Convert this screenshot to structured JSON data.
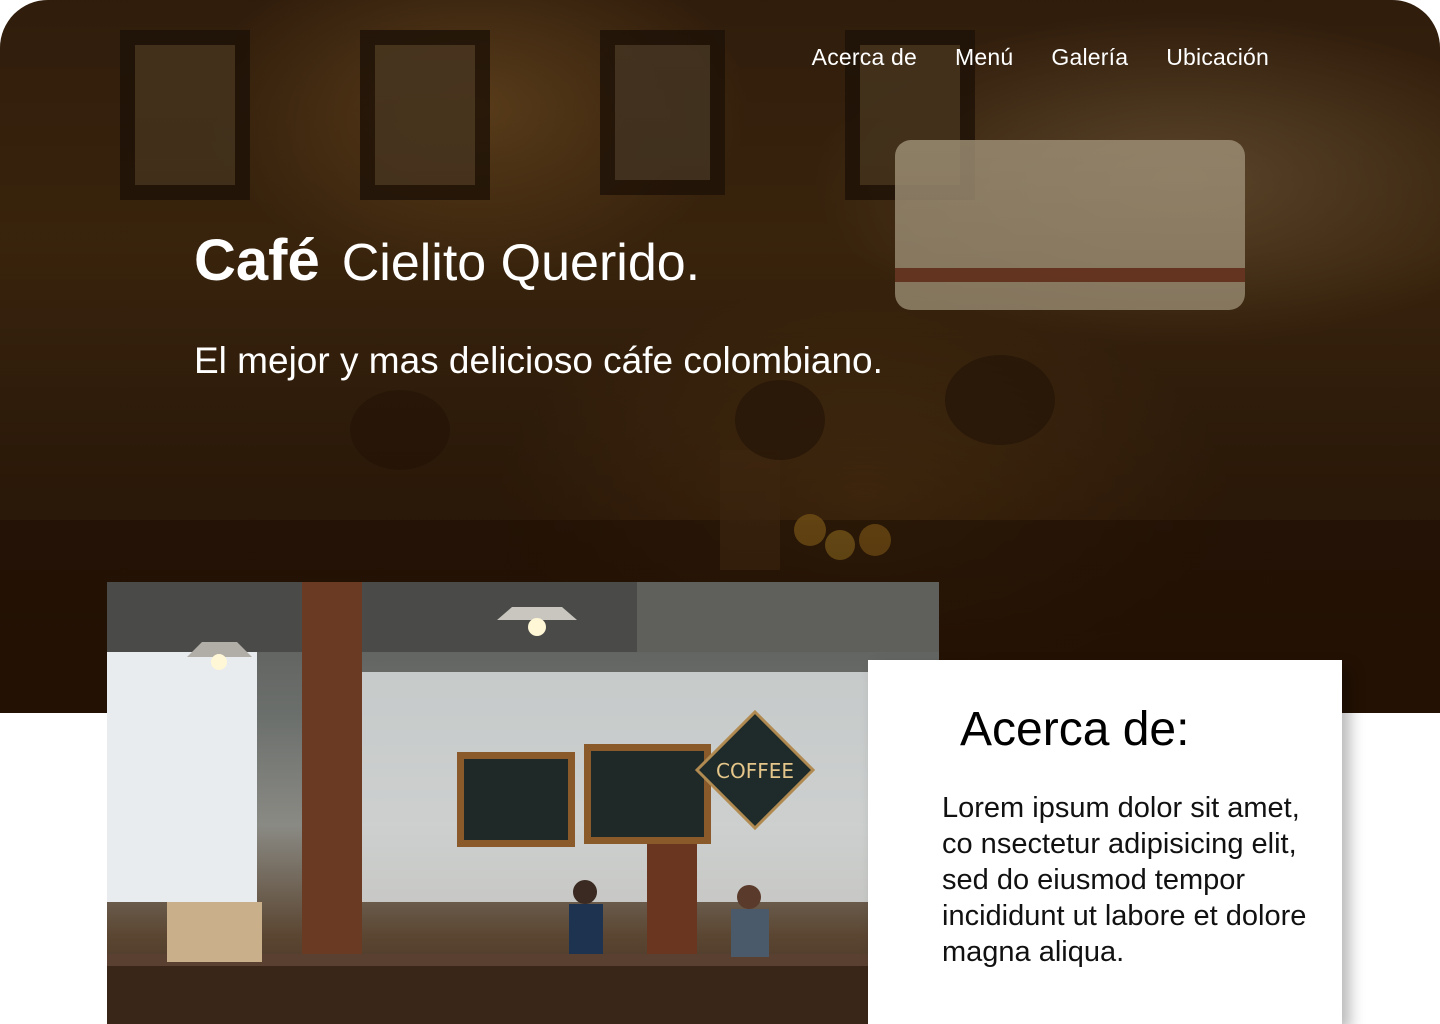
{
  "nav": {
    "items": [
      {
        "label": "Acerca de"
      },
      {
        "label": "Menú"
      },
      {
        "label": "Galería"
      },
      {
        "label": "Ubicación"
      }
    ]
  },
  "hero": {
    "title_bold": "Café",
    "title_light": "Cielito Querido.",
    "subtitle": "El mejor y mas delicioso cáfe colombiano."
  },
  "about": {
    "heading": "Acerca de:",
    "body": "Lorem ipsum dolor sit amet, co nsectetur adipisicing elit, sed do eiusmod tempor incididunt ut labore et dolore magna aliqua."
  },
  "images": {
    "hero": "cafe-interior-photo",
    "about": "coffee-shop-counter-photo"
  },
  "colors": {
    "hero_bg": "#3a2410",
    "text_on_hero": "#ffffff",
    "card_bg": "#ffffff"
  }
}
